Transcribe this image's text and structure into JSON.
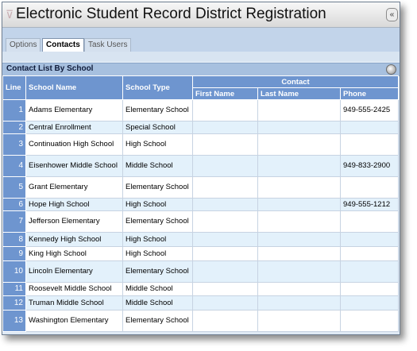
{
  "window": {
    "title": "Electronic Student Record District Registration",
    "collapse_icon": "«"
  },
  "tabs": [
    {
      "label": "Options",
      "active": false
    },
    {
      "label": "Contacts",
      "active": true
    },
    {
      "label": "Task Users",
      "active": false
    }
  ],
  "panel": {
    "title": "Contact List By School"
  },
  "table": {
    "headers": {
      "line": "Line",
      "school_name": "School Name",
      "school_type": "School Type",
      "contact": "Contact",
      "first_name": "First Name",
      "last_name": "Last Name",
      "phone": "Phone"
    },
    "rows": [
      {
        "line": "1",
        "school": "Adams Elementary",
        "type": "Elementary School",
        "first": "",
        "last": "",
        "phone": "949-555-2425"
      },
      {
        "line": "2",
        "school": "Central Enrollment",
        "type": "Special School",
        "first": "",
        "last": "",
        "phone": ""
      },
      {
        "line": "3",
        "school": "Continuation High School",
        "type": "High School",
        "first": "",
        "last": "",
        "phone": ""
      },
      {
        "line": "4",
        "school": "Eisenhower Middle School",
        "type": "Middle School",
        "first": "",
        "last": "",
        "phone": "949-833-2900"
      },
      {
        "line": "5",
        "school": "Grant Elementary",
        "type": "Elementary School",
        "first": "",
        "last": "",
        "phone": ""
      },
      {
        "line": "6",
        "school": "Hope High School",
        "type": "High School",
        "first": "",
        "last": "",
        "phone": "949-555-1212"
      },
      {
        "line": "7",
        "school": "Jefferson Elementary",
        "type": "Elementary School",
        "first": "",
        "last": "",
        "phone": ""
      },
      {
        "line": "8",
        "school": "Kennedy High School",
        "type": "High School",
        "first": "",
        "last": "",
        "phone": ""
      },
      {
        "line": "9",
        "school": "King High School",
        "type": "High School",
        "first": "",
        "last": "",
        "phone": ""
      },
      {
        "line": "10",
        "school": "Lincoln Elementary",
        "type": "Elementary School",
        "first": "",
        "last": "",
        "phone": ""
      },
      {
        "line": "11",
        "school": "Roosevelt Middle School",
        "type": "Middle School",
        "first": "",
        "last": "",
        "phone": ""
      },
      {
        "line": "12",
        "school": "Truman Middle School",
        "type": "Middle School",
        "first": "",
        "last": "",
        "phone": ""
      },
      {
        "line": "13",
        "school": "Washington Elementary",
        "type": "Elementary School",
        "first": "",
        "last": "",
        "phone": ""
      }
    ]
  },
  "colors": {
    "header_blue": "#6e95cf",
    "alt_row": "#e3f1fb",
    "panel_header": "#a7c0df",
    "tabbar": "#c2d4ea"
  }
}
